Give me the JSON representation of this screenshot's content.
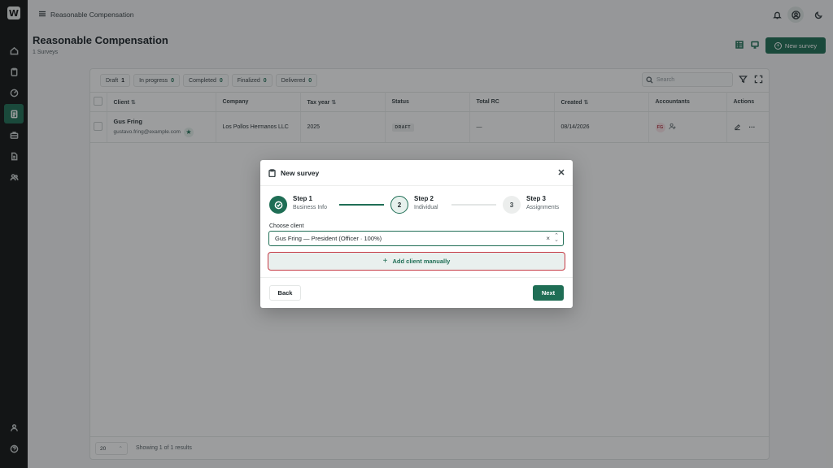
{
  "app": {
    "logo_text": "W",
    "breadcrumb": "Reasonable Compensation"
  },
  "page": {
    "title": "Reasonable Compensation",
    "subtitle": "1 Surveys",
    "new_survey_label": "New survey"
  },
  "filters": [
    {
      "label": "Draft",
      "count": "1"
    },
    {
      "label": "In progress",
      "count": "0"
    },
    {
      "label": "Completed",
      "count": "0"
    },
    {
      "label": "Finalized",
      "count": "0"
    },
    {
      "label": "Delivered",
      "count": "0"
    }
  ],
  "search": {
    "placeholder": "Search"
  },
  "table": {
    "columns": [
      "Client",
      "Company",
      "Tax year",
      "Status",
      "Total RC",
      "Created",
      "Accountants",
      "Actions"
    ],
    "rows": [
      {
        "client_name": "Gus Fring",
        "client_email": "gustavo.fring@example.com",
        "company": "Los Pollos Hermanos LLC",
        "tax_year": "2025",
        "status": "DRAFT",
        "total_rc": "—",
        "created": "08/14/2026",
        "accountant_initials": "FG"
      }
    ]
  },
  "pagination": {
    "page_size": "20",
    "showing": "Showing 1 of 1 results"
  },
  "modal": {
    "title": "New survey",
    "steps": [
      {
        "label": "Step 1",
        "sub": "Business Info",
        "state": "done"
      },
      {
        "label": "Step 2",
        "sub": "Individual",
        "number": "2",
        "state": "current"
      },
      {
        "label": "Step 3",
        "sub": "Assignments",
        "number": "3",
        "state": "future"
      }
    ],
    "choose_label": "Choose client",
    "selected_client": "Gus Fring — President (Officer · 100%)",
    "add_manual_label": "Add client manually",
    "back_label": "Back",
    "next_label": "Next"
  },
  "colors": {
    "accent": "#1f6e55",
    "highlight": "#c53a44",
    "sidebar": "#131516"
  }
}
